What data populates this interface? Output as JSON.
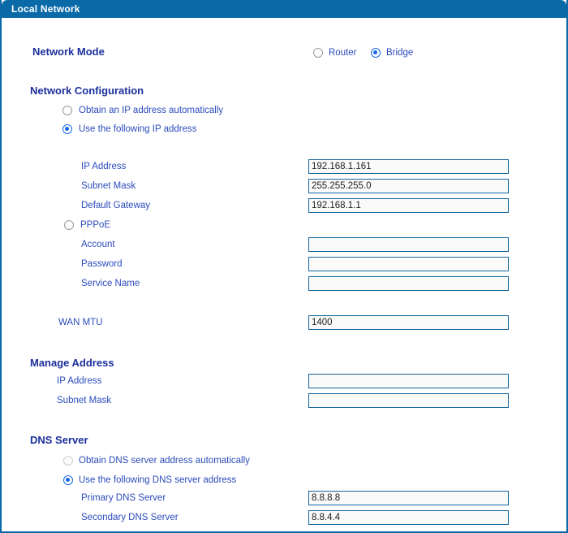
{
  "window": {
    "title": "Local Network"
  },
  "colors": {
    "header_bg": "#0a6aa8",
    "heading_text": "#1a2f9c",
    "label_text": "#2b4bbd",
    "accent_radio": "#1667e8",
    "input_border": "#1565a0"
  },
  "network_mode": {
    "heading": "Network Mode",
    "options": [
      {
        "label": "Router",
        "selected": false
      },
      {
        "label": "Bridge",
        "selected": true
      }
    ]
  },
  "network_configuration": {
    "heading": "Network Configuration",
    "obtain_auto": {
      "label": "Obtain an IP address automatically",
      "selected": false
    },
    "use_following": {
      "label": "Use the following IP address",
      "selected": true
    },
    "fields": [
      {
        "label": "IP Address",
        "value": "192.168.1.161",
        "placeholder": ""
      },
      {
        "label": "Subnet Mask",
        "value": "255.255.255.0",
        "placeholder": ""
      },
      {
        "label": "Default Gateway",
        "value": "192.168.1.1",
        "placeholder": ""
      }
    ],
    "pppoe": {
      "label": "PPPoE",
      "selected": false
    },
    "pppoe_fields": [
      {
        "label": "Account",
        "value": "",
        "placeholder": ""
      },
      {
        "label": "Password",
        "value": "",
        "placeholder": ""
      },
      {
        "label": "Service Name",
        "value": "",
        "placeholder": ""
      }
    ],
    "wan_mtu": {
      "label": "WAN MTU",
      "value": "1400",
      "placeholder": ""
    }
  },
  "manage_address": {
    "heading": "Manage Address",
    "fields": [
      {
        "label": "IP Address",
        "value": "",
        "placeholder": ""
      },
      {
        "label": "Subnet Mask",
        "value": "",
        "placeholder": ""
      }
    ]
  },
  "dns_server": {
    "heading": "DNS Server",
    "obtain_auto": {
      "label": "Obtain DNS server address automatically",
      "selected": false,
      "disabled": true
    },
    "use_following": {
      "label": "Use the following DNS server address",
      "selected": true
    },
    "fields": [
      {
        "label": "Primary DNS Server",
        "value": "8.8.8.8",
        "placeholder": ""
      },
      {
        "label": "Secondary DNS Server",
        "value": "8.8.4.4",
        "placeholder": ""
      }
    ]
  }
}
